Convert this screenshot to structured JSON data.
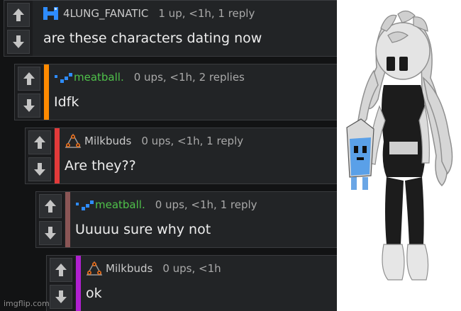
{
  "comments": [
    {
      "username": "4LUNG_FANATIC",
      "meta": "1 up, <1h, 1 reply",
      "text": "are these characters dating now",
      "bar_color": "#222426",
      "name_color": "#c9c9c9",
      "avatar": "blue-block-avatar-icon"
    },
    {
      "username": "meatball.",
      "meta": "0 ups, <1h, 2 replies",
      "text": "Idfk",
      "bar_color": "#ff8a00",
      "name_color": "#4fc14a",
      "avatar": "blue-pixel-avatar-icon"
    },
    {
      "username": "Milkbuds",
      "meta": "0 ups, <1h, 1 reply",
      "text": "Are they??",
      "bar_color": "#e23a3a",
      "name_color": "#c9c9c9",
      "avatar": "star-triangle-avatar-icon"
    },
    {
      "username": "meatball.",
      "meta": "0 ups, <1h, 1 reply",
      "text": "Uuuuu sure why not",
      "bar_color": "#8a5555",
      "name_color": "#4fc14a",
      "avatar": "blue-pixel-avatar-icon"
    },
    {
      "username": "Milkbuds",
      "meta": "0 ups, <1h",
      "text": "ok",
      "bar_color": "#b020d0",
      "name_color": "#c9c9c9",
      "avatar": "star-triangle-avatar-icon"
    }
  ],
  "watermark": "imgflip.com",
  "side_image": "character-figure-image"
}
